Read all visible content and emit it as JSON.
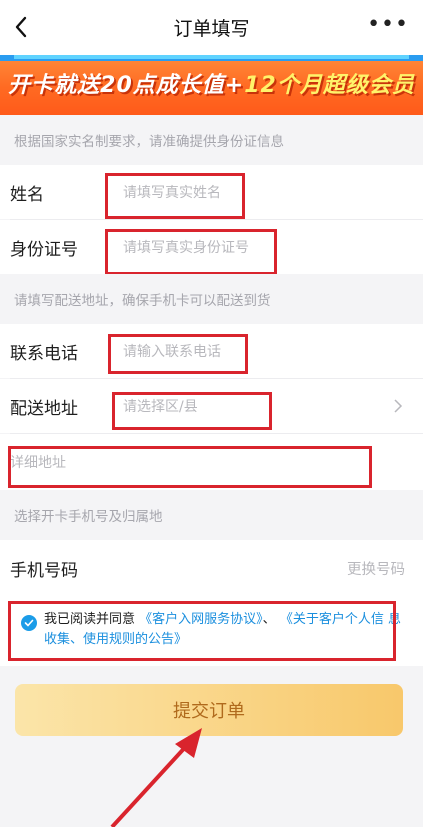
{
  "nav": {
    "title": "订单填写",
    "more": "•••"
  },
  "banner": {
    "text_part1": "开卡就送20点成长值+",
    "text_part2": "12个月超级会员"
  },
  "notes": {
    "id_note": "根据国家实名制要求，请准确提供身份证信息",
    "address_note": "请填写配送地址，确保手机卡可以配送到货",
    "phone_note": "选择开卡手机号及归属地"
  },
  "form": {
    "name": {
      "label": "姓名",
      "placeholder": "请填写真实姓名"
    },
    "id_number": {
      "label": "身份证号",
      "placeholder": "请填写真实身份证号"
    },
    "contact_phone": {
      "label": "联系电话",
      "placeholder": "请输入联系电话"
    },
    "address": {
      "label": "配送地址",
      "placeholder": "请选择区/县"
    },
    "detail_address": {
      "placeholder": "详细地址"
    },
    "mobile": {
      "label": "手机号码",
      "action": "更换号码"
    }
  },
  "agreement": {
    "prefix": "我已阅读并同意",
    "link1": "《客户入网服务协议》",
    "sep": "、",
    "link2": "《关于客户个人信 息收集、使用规则的公告》"
  },
  "submit": {
    "label": "提交订单"
  },
  "colors": {
    "accent_blue": "#1b9ce8",
    "annotation_red": "#d9242d",
    "button_gold": "#f8c86b"
  }
}
